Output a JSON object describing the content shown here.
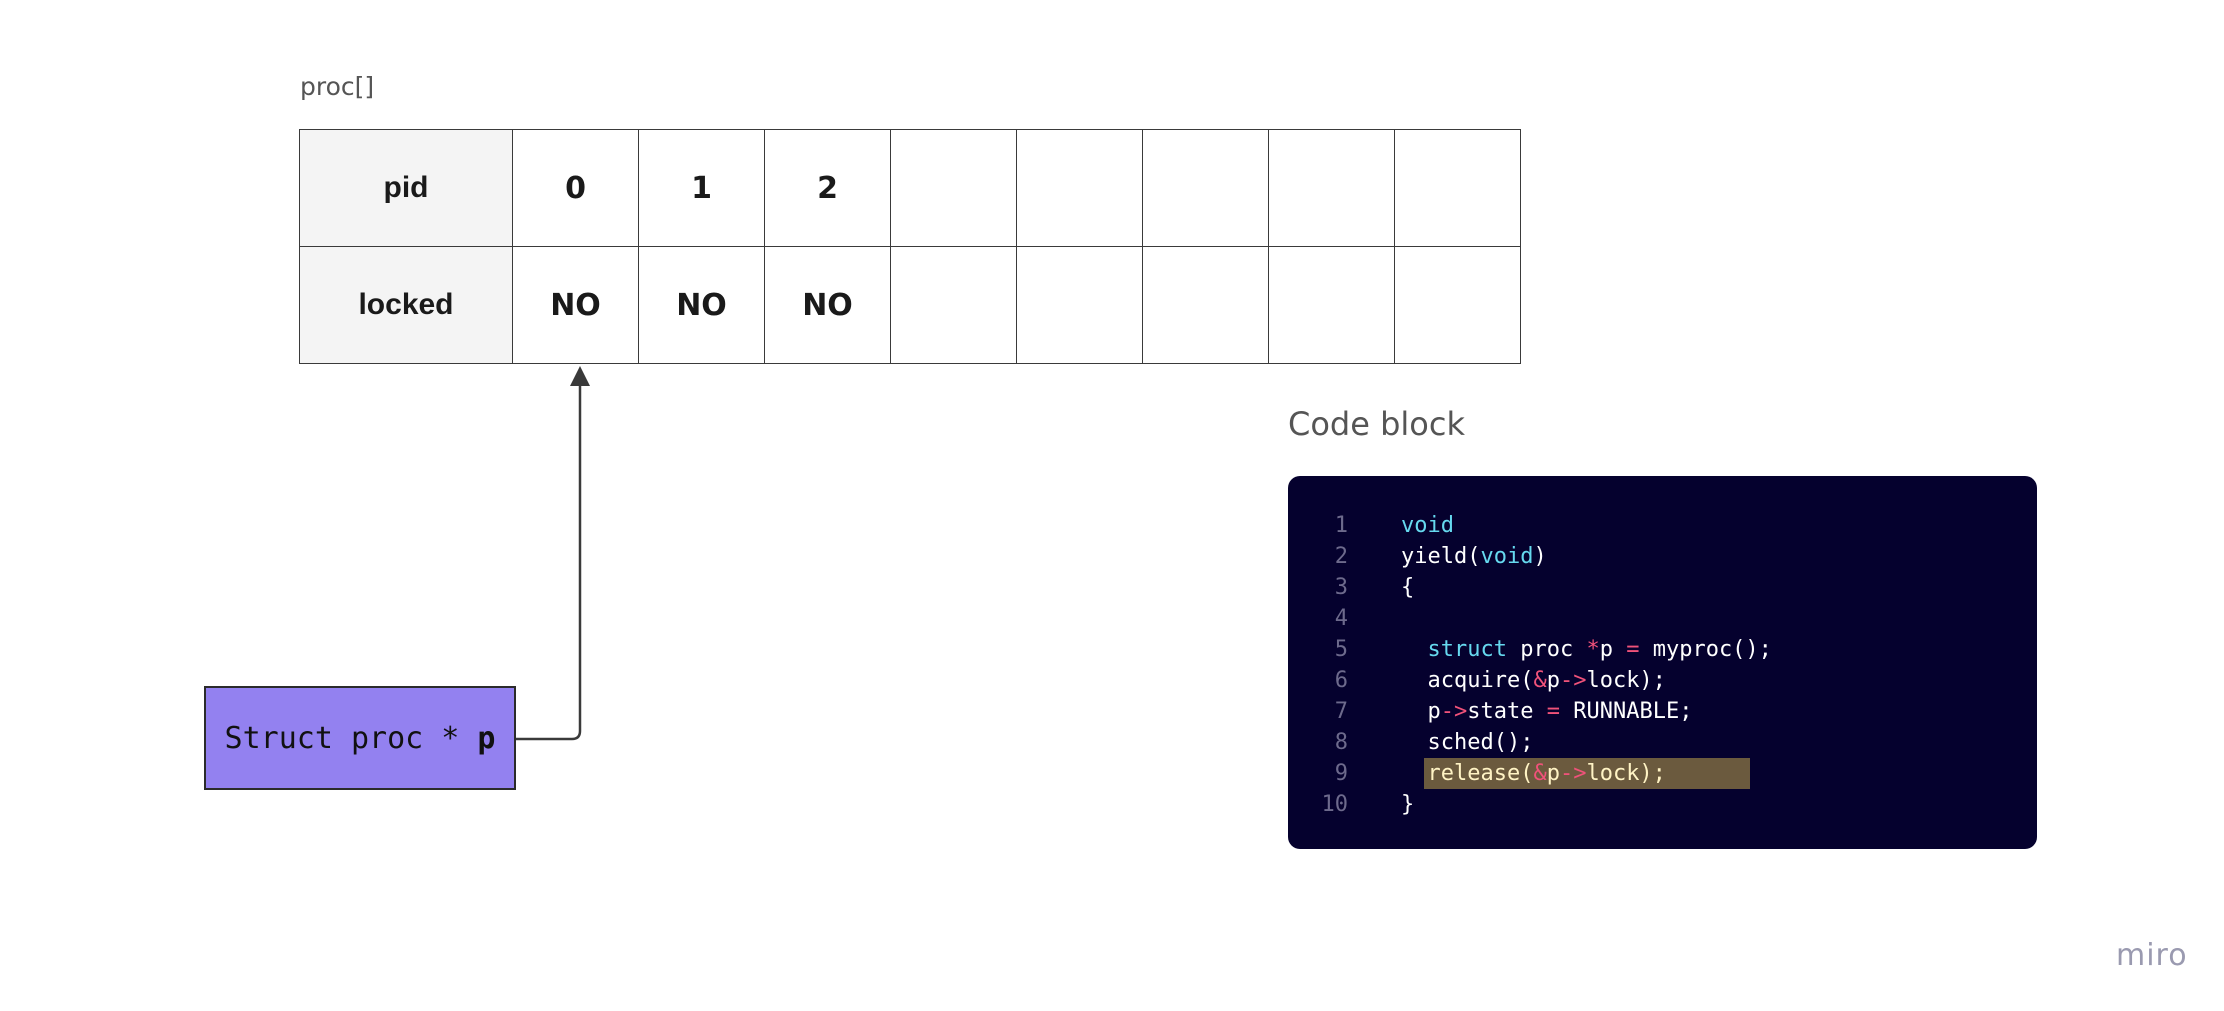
{
  "table": {
    "title": "proc[]",
    "rows": [
      {
        "header": "pid",
        "cells": [
          "0",
          "1",
          "2",
          "",
          "",
          "",
          "",
          ""
        ]
      },
      {
        "header": "locked",
        "cells": [
          "NO",
          "NO",
          "NO",
          "",
          "",
          "",
          "",
          ""
        ]
      }
    ]
  },
  "pointer": {
    "label": "Struct proc * ",
    "var": "p"
  },
  "code_block": {
    "title": "Code block",
    "highlighted_line": 9,
    "lines": [
      {
        "no": "1",
        "tokens": [
          {
            "t": "void",
            "c": "kw"
          }
        ]
      },
      {
        "no": "2",
        "tokens": [
          {
            "t": "yield(",
            "c": ""
          },
          {
            "t": "void",
            "c": "kw"
          },
          {
            "t": ")",
            "c": ""
          }
        ]
      },
      {
        "no": "3",
        "tokens": [
          {
            "t": "{",
            "c": ""
          }
        ]
      },
      {
        "no": "4",
        "tokens": []
      },
      {
        "no": "5",
        "tokens": [
          {
            "t": "  ",
            "c": ""
          },
          {
            "t": "struct",
            "c": "kw"
          },
          {
            "t": " proc ",
            "c": ""
          },
          {
            "t": "*",
            "c": "op"
          },
          {
            "t": "p ",
            "c": ""
          },
          {
            "t": "=",
            "c": "op"
          },
          {
            "t": " myproc();",
            "c": ""
          }
        ]
      },
      {
        "no": "6",
        "tokens": [
          {
            "t": "  acquire(",
            "c": ""
          },
          {
            "t": "&",
            "c": "op"
          },
          {
            "t": "p",
            "c": ""
          },
          {
            "t": "->",
            "c": "op"
          },
          {
            "t": "lock);",
            "c": ""
          }
        ]
      },
      {
        "no": "7",
        "tokens": [
          {
            "t": "  p",
            "c": ""
          },
          {
            "t": "->",
            "c": "op"
          },
          {
            "t": "state ",
            "c": ""
          },
          {
            "t": "=",
            "c": "op"
          },
          {
            "t": " RUNNABLE;",
            "c": ""
          }
        ]
      },
      {
        "no": "8",
        "tokens": [
          {
            "t": "  sched();",
            "c": ""
          }
        ]
      },
      {
        "no": "9",
        "tokens": [
          {
            "t": "  release(",
            "c": ""
          },
          {
            "t": "&",
            "c": "op"
          },
          {
            "t": "p",
            "c": ""
          },
          {
            "t": "->",
            "c": "op"
          },
          {
            "t": "lock);",
            "c": ""
          }
        ]
      },
      {
        "no": "10",
        "tokens": [
          {
            "t": "}",
            "c": ""
          }
        ]
      }
    ]
  },
  "colors": {
    "pointer_fill": "#9381f0",
    "code_bg": "#05012e",
    "keyword": "#66d9ef",
    "operator": "#f0527a",
    "highlight": "#6b5a3e"
  },
  "brand": "miro"
}
